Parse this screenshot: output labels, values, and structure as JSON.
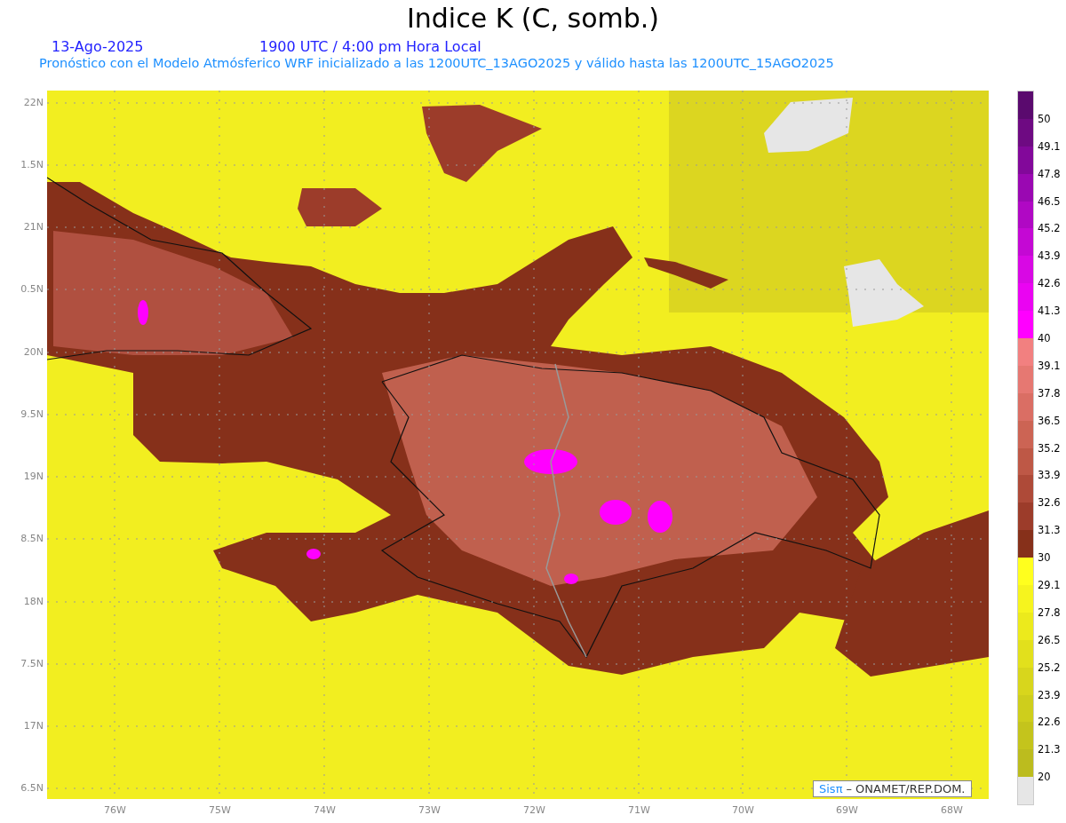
{
  "title": "Indice K (C, somb.)",
  "date": "13-Ago-2025",
  "time": "1900 UTC / 4:00 pm Hora Local",
  "subtitle": "Pronóstico con el Modelo Atmósferico WRF inicializado a las 1200UTC_13AGO2025 y válido hasta las  1200UTC_15AGO2025",
  "map": {
    "y_labels": [
      "22N",
      "1.5N",
      "21N",
      "0.5N",
      "20N",
      "9.5N",
      "19N",
      "8.5N",
      "18N",
      "7.5N",
      "17N",
      "6.5N"
    ],
    "x_labels": [
      "76W",
      "75W",
      "74W",
      "73W",
      "72W",
      "71W",
      "70W",
      "69W",
      "68W"
    ],
    "credit": {
      "brand": "Sisπ",
      "text": "– ONAMET/REP.DOM."
    }
  },
  "legend": [
    {
      "color": "#5a0a6e",
      "label": "50"
    },
    {
      "color": "#6e0a82",
      "label": "49.1"
    },
    {
      "color": "#82089a",
      "label": "47.8"
    },
    {
      "color": "#9a08b2",
      "label": "46.5"
    },
    {
      "color": "#b008c4",
      "label": "45.2"
    },
    {
      "color": "#c408d4",
      "label": "43.9"
    },
    {
      "color": "#d808e4",
      "label": "42.6"
    },
    {
      "color": "#ea04f2",
      "label": "41.3"
    },
    {
      "color": "#ff00ff",
      "label": "40"
    },
    {
      "color": "#f28080",
      "label": "39.1"
    },
    {
      "color": "#e67872",
      "label": "37.8"
    },
    {
      "color": "#da6e64",
      "label": "36.5"
    },
    {
      "color": "#cc6454",
      "label": "35.2"
    },
    {
      "color": "#be5846",
      "label": "33.9"
    },
    {
      "color": "#ae4a38",
      "label": "32.6"
    },
    {
      "color": "#9c3c2a",
      "label": "31.3"
    },
    {
      "color": "#86301a",
      "label": "30"
    },
    {
      "color": "#ffff1e",
      "label": "29.1"
    },
    {
      "color": "#f6f41e",
      "label": "27.8"
    },
    {
      "color": "#ecea1c",
      "label": "26.5"
    },
    {
      "color": "#e2e01c",
      "label": "25.2"
    },
    {
      "color": "#d8d61c",
      "label": "23.9"
    },
    {
      "color": "#cece1c",
      "label": "22.6"
    },
    {
      "color": "#c4c41c",
      "label": "21.3"
    },
    {
      "color": "#bcbc1e",
      "label": "20"
    },
    {
      "color": "#e6e6e6"
    }
  ]
}
